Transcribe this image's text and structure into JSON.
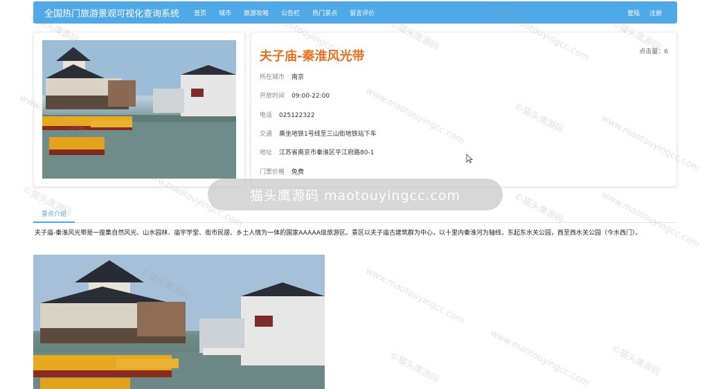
{
  "nav": {
    "brand": "全国热门旅游景观可视化查询系统",
    "links": [
      "首页",
      "城市",
      "旅游攻略",
      "公告栏",
      "热门景点",
      "留言评价"
    ],
    "login": "登陆",
    "register": "注册"
  },
  "attraction": {
    "name": "夫子庙-秦淮风光带",
    "clicks_label": "点击量",
    "clicks": "6",
    "fields": [
      {
        "label": "所在城市",
        "value": "南京"
      },
      {
        "label": "开放时间",
        "value": "09:00-22:00"
      },
      {
        "label": "电话",
        "value": "025122322"
      },
      {
        "label": "交通",
        "value": "乘坐地铁1号线至三山街地铁站下车"
      },
      {
        "label": "地址",
        "value": "江苏省南京市秦淮区平江府路80-1"
      },
      {
        "label": "门票价格",
        "value": "免费"
      }
    ]
  },
  "tabs": {
    "intro": "景点介绍"
  },
  "description": "夫子庙-秦淮风光带是一座集自然风光、山水园林、庙宇学堂、街市民居、乡土人情为一体的国家AAAAA级旅游区。景区以夫子庙古建筑群为中心，以十里内秦淮河为轴线，东起东水关公园，西至西水关公园（今水西门）。",
  "watermark": {
    "banner": "猫头鹰源码 maotouyingcc.com",
    "tile_a": "©猫头鹰源码",
    "tile_b": "www.maotouyingcc.com"
  },
  "colors": {
    "nav_bg": "#4fa9e6",
    "title": "#e8711e"
  }
}
